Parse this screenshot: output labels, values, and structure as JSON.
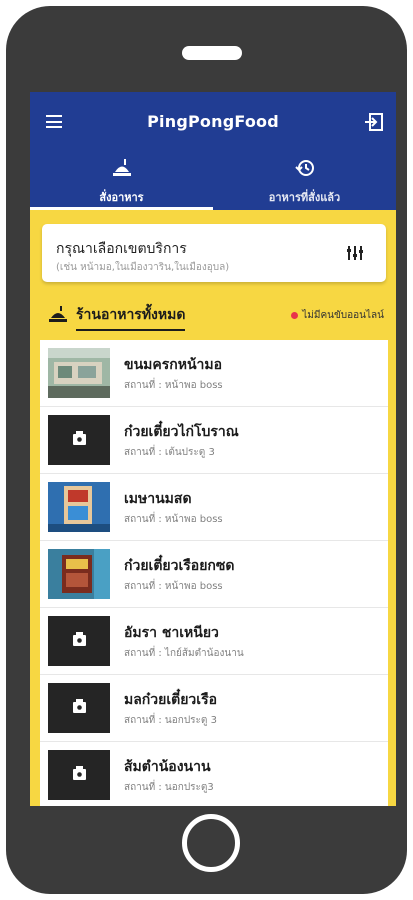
{
  "app": {
    "title": "PingPongFood"
  },
  "tabs": [
    {
      "label": "สั่งอาหาร",
      "icon": "food-tray-icon",
      "active": true
    },
    {
      "label": "อาหารที่สั่งแล้ว",
      "icon": "history-icon",
      "active": false
    }
  ],
  "region_selector": {
    "title": "กรุณาเลือกเขตบริการ",
    "hint": "(เช่น หน้ามอ,ในเมืองวาริน,ในเมืองอุบล)",
    "icon": "filter-icon"
  },
  "section": {
    "title": "ร้านอาหารทั้งหมด",
    "status_text": "ไม่มีคนขับออนไลน์",
    "status_color": "#e8344b"
  },
  "restaurants": [
    {
      "name": "ขนมครกหน้ามอ",
      "location": "สถานที่ : หน้าพอ boss",
      "thumb": "photo-stall"
    },
    {
      "name": "ก๋วยเตี๋ยวไก่โบราณ",
      "location": "สถานที่ : เต้นประตู 3",
      "thumb": "placeholder"
    },
    {
      "name": "เมษานมสด",
      "location": "สถานที่ : หน้าพอ boss",
      "thumb": "photo-blue"
    },
    {
      "name": "ก๋วยเตี๋ยวเรือยกซด",
      "location": "สถานที่ : หน้าพอ boss",
      "thumb": "photo-menu"
    },
    {
      "name": "อัมรา ชาเหนียว",
      "location": "สถานที่ : ไกย์ส้มตำน้องนาน",
      "thumb": "placeholder"
    },
    {
      "name": "มลก๋วยเตี๋ยวเรือ",
      "location": "สถานที่ : นอกประตู 3",
      "thumb": "placeholder"
    },
    {
      "name": "ส้มตำน้องนาน",
      "location": "สถานที่ : นอกประตู3",
      "thumb": "placeholder"
    }
  ],
  "colors": {
    "primary": "#213d93",
    "background": "#f7d742",
    "phone": "#3b3b3b"
  }
}
